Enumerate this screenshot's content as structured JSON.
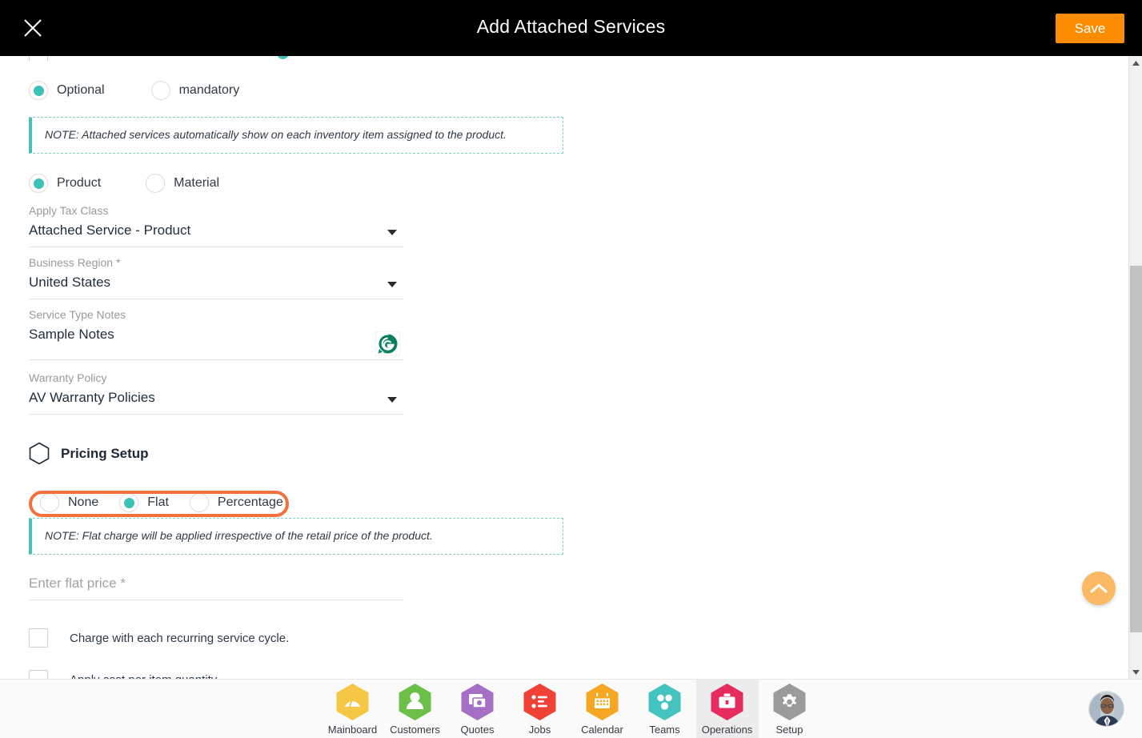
{
  "header": {
    "title": "Add Attached Services",
    "close_icon": "close-icon",
    "save_label": "Save",
    "save_color": "#FB8C00"
  },
  "theme": {
    "accent_teal": "#3CC2B6",
    "highlight_orange": "#F4703A",
    "note_border": "#7ecfc8"
  },
  "form": {
    "cut_row": {
      "label": "",
      "visible_fragment": true
    },
    "requirement_group": {
      "name": "requirement",
      "options": [
        {
          "label": "Optional",
          "selected": true
        },
        {
          "label": "mandatory",
          "selected": false
        }
      ]
    },
    "note_attached": "NOTE: Attached services automatically show on each inventory item assigned to the product.",
    "type_group": {
      "name": "item-type",
      "options": [
        {
          "label": "Product",
          "selected": true
        },
        {
          "label": "Material",
          "selected": false
        }
      ]
    },
    "fields": [
      {
        "name": "apply-tax-class",
        "label": "Apply Tax Class",
        "value": "Attached Service - Product",
        "control": "dropdown"
      },
      {
        "name": "business-region",
        "label": "Business Region *",
        "value": "United States",
        "control": "dropdown"
      },
      {
        "name": "service-type-notes",
        "label": "Service Type Notes",
        "value": "Sample Notes",
        "control": "text",
        "addon_icon": "grammarly-icon"
      },
      {
        "name": "warranty-policy",
        "label": "Warranty Policy",
        "value": "AV Warranty Policies",
        "control": "dropdown"
      }
    ],
    "pricing_section": {
      "icon": "hexagon-outline-icon",
      "title": "Pricing Setup",
      "pricing_group": {
        "name": "pricing-mode",
        "highlighted": true,
        "options": [
          {
            "label": "None",
            "selected": false
          },
          {
            "label": "Flat",
            "selected": true
          },
          {
            "label": "Percentage",
            "selected": false
          }
        ]
      },
      "note_flat": "NOTE: Flat charge will be applied irrespective of the retail price of the product.",
      "flat_price": {
        "name": "enter-flat-price",
        "placeholder": "Enter flat price *",
        "value": ""
      },
      "checkboxes": [
        {
          "label": "Charge with each recurring service cycle.",
          "checked": false
        },
        {
          "label": "Apply cost per item quantity.",
          "checked": false
        }
      ]
    }
  },
  "fab": {
    "name": "scroll-to-top-button",
    "icon": "chevron-up-icon",
    "color": "#FBB963"
  },
  "scrollbar": {
    "up_icon": "caret-up-icon",
    "down_icon": "caret-down-icon"
  },
  "bottom_nav": {
    "items": [
      {
        "label": "Mainboard",
        "icon": "dashboard-icon",
        "color": "#F6C744",
        "active": false
      },
      {
        "label": "Customers",
        "icon": "person-icon",
        "color": "#6CC04A",
        "active": false
      },
      {
        "label": "Quotes",
        "icon": "quote-cards-icon",
        "color": "#A46FC4",
        "active": false
      },
      {
        "label": "Jobs",
        "icon": "checklist-icon",
        "color": "#EF4136",
        "active": false
      },
      {
        "label": "Calendar",
        "icon": "calendar-icon",
        "color": "#F5A623",
        "active": false
      },
      {
        "label": "Teams",
        "icon": "team-dots-icon",
        "color": "#45C3C1",
        "active": false
      },
      {
        "label": "Operations",
        "icon": "briefcase-icon",
        "color": "#E62B5E",
        "active": true
      },
      {
        "label": "Setup",
        "icon": "gear-icon",
        "color": "#9B9B9B",
        "active": false
      }
    ],
    "avatar": {
      "name": "user-avatar"
    }
  }
}
